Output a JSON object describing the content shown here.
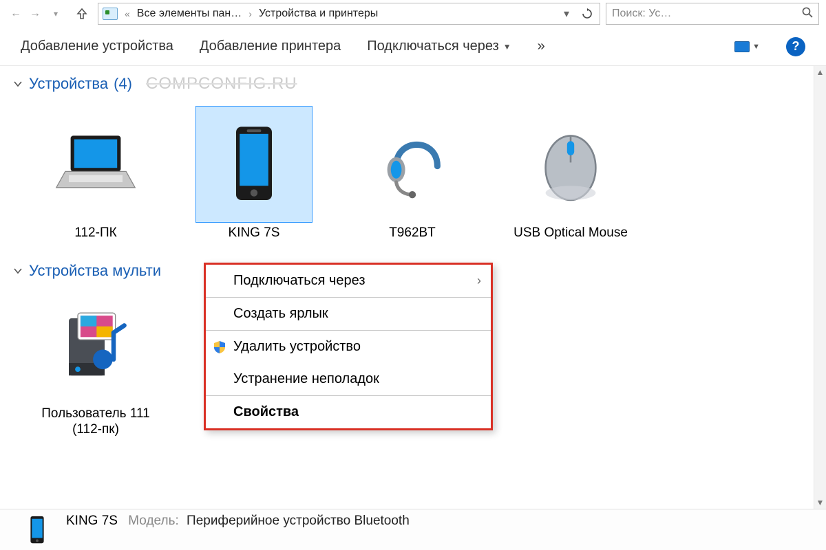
{
  "addressbar": {
    "crumb1": "Все элементы пан…",
    "crumb2": "Устройства и принтеры"
  },
  "search": {
    "placeholder": "Поиск: Ус…"
  },
  "toolbar": {
    "add_device": "Добавление устройства",
    "add_printer": "Добавление принтера",
    "connect_via": "Подключаться через",
    "overflow": "»"
  },
  "groups": {
    "devices": {
      "title": "Устройства",
      "count": "(4)"
    },
    "multimedia": {
      "title": "Устройства мульти"
    }
  },
  "watermark": "COMPCONFIG.RU",
  "devices": [
    {
      "label": "112-ПК"
    },
    {
      "label": "KING 7S"
    },
    {
      "label": "T962BT"
    },
    {
      "label": "USB Optical Mouse"
    }
  ],
  "multimedia_device": {
    "label": "Пользователь 111 (112-пк)"
  },
  "context_menu": {
    "connect_via": "Подключаться через",
    "create_shortcut": "Создать ярлык",
    "remove_device": "Удалить устройство",
    "troubleshoot": "Устранение неполадок",
    "properties": "Свойства"
  },
  "details": {
    "name": "KING 7S",
    "model_label": "Модель:",
    "model_value": "Периферийное устройство Bluetooth"
  }
}
